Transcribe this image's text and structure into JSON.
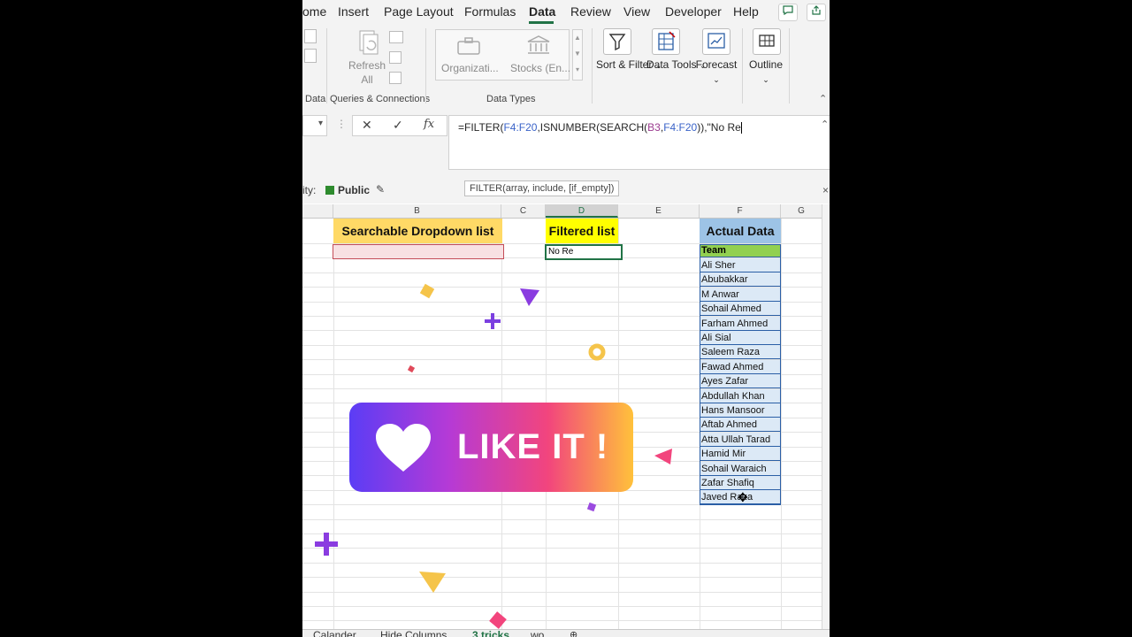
{
  "menu": {
    "items": [
      "ome",
      "Insert",
      "Page Layout",
      "Formulas",
      "Data",
      "Review",
      "View",
      "Developer",
      "Help"
    ],
    "active": "Data"
  },
  "ribbon": {
    "refresh_all": "Refresh All",
    "queries_group": "Queries & Connections",
    "data_group_fragment": "Data",
    "organization": "Organizati...",
    "stocks": "Stocks (En...",
    "data_types_group": "Data Types",
    "sort_filter": "Sort & Filter",
    "data_tools": "Data Tools",
    "forecast": "Forecast",
    "outline": "Outline"
  },
  "formula_bar": {
    "namebox_chevron": "▾",
    "cancel_icon": "✕",
    "enter_icon": "✓",
    "fx_label": "fx",
    "formula_parts": [
      "=FILTER(",
      "F4:F20",
      ",ISNUMBER(SEARCH(",
      "B3",
      ",",
      "F4:F20",
      ")),\"No Re"
    ]
  },
  "infobar": {
    "sensitivity_prefix": "ity:",
    "sensitivity_value": "Public",
    "tooltip": "FILTER(array, include, [if_empty])"
  },
  "sheet": {
    "columns": [
      "B",
      "C",
      "D",
      "E",
      "F",
      "G"
    ],
    "selected_column": "D",
    "headers": {
      "searchable": "Searchable Dropdown list",
      "filtered": "Filtered list",
      "actual": "Actual Data"
    },
    "filtered_value": "No Re",
    "team_header": "Team",
    "team_members": [
      "Ali Sher",
      "Abubakkar",
      "M Anwar",
      "Sohail Ahmed",
      "Farham Ahmed",
      "Ali Sial",
      "Saleem Raza",
      "Fawad Ahmed",
      "Ayes Zafar",
      "Abdullah Khan",
      "Hans Mansoor",
      "Aftab Ahmed",
      "Atta Ullah Tarad",
      "Hamid Mir",
      "Sohail Waraich",
      "Zafar Shafiq",
      "Javed Raza"
    ]
  },
  "tabs": [
    "Calander",
    "Hide Columns",
    "3 tricks",
    "wo"
  ],
  "active_tab": "3 tricks",
  "overlay": {
    "like_text": "LIKE IT !"
  },
  "colors": {
    "excel_green": "#217346",
    "searchable_header_bg": "#ffd966",
    "filtered_header_bg": "#ffff00",
    "actual_header_bg": "#9dc3e6",
    "team_header_bg": "#92d050",
    "data_fill": "#dce9f6"
  }
}
